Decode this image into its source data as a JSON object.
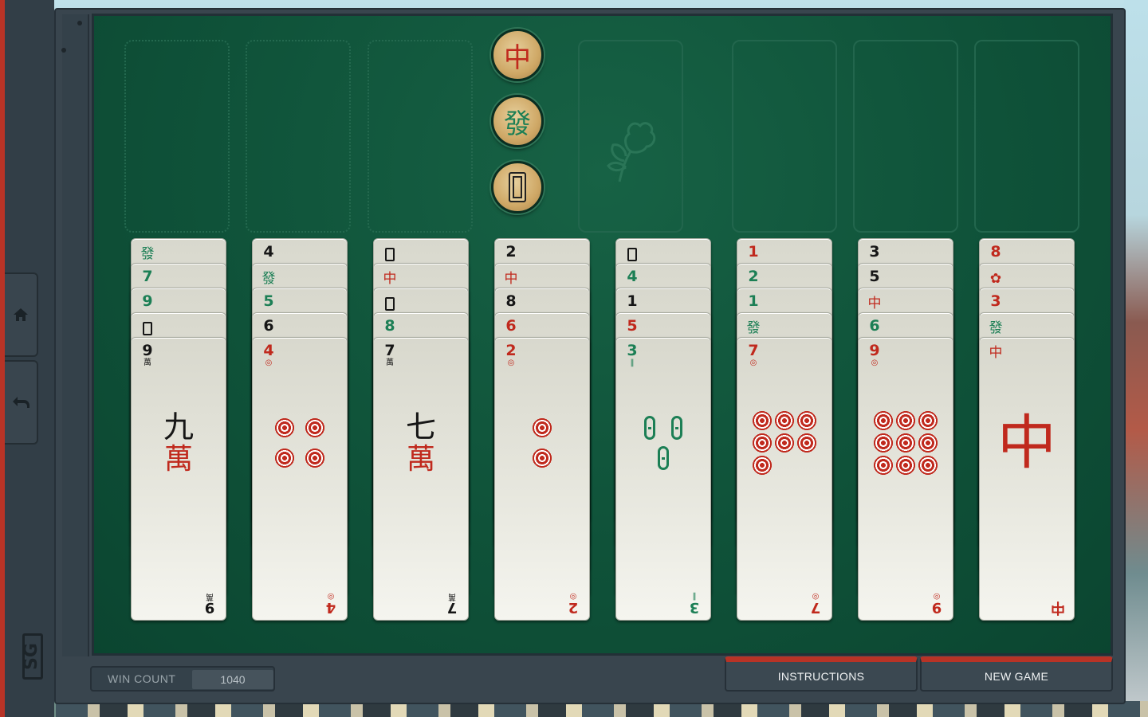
{
  "rail": {
    "home_icon": "home-icon",
    "undo_icon": "undo-icon",
    "logo_text": "SG"
  },
  "colors": {
    "felt": "#0f5239",
    "accent": "#b83326",
    "tile_red": "#c0291d",
    "tile_green": "#1c7f55",
    "tile_black": "#161616"
  },
  "dragon_buttons": [
    {
      "glyph": "中",
      "name": "red-dragon",
      "color": "red"
    },
    {
      "glyph": "發",
      "name": "green-dragon",
      "color": "green"
    },
    {
      "glyph": "",
      "name": "white-dragon",
      "color": "white"
    }
  ],
  "flower_slot": {
    "icon": "flower-icon"
  },
  "columns": [
    {
      "tags": [
        {
          "text": "發",
          "sub": "",
          "color": "green",
          "honor": true
        },
        {
          "text": "7",
          "sub": "",
          "color": "green",
          "honor": false
        },
        {
          "text": "9",
          "sub": "",
          "color": "green",
          "honor": false
        },
        {
          "text": "",
          "sub": "",
          "color": "black",
          "honor": true,
          "white": true
        },
        {
          "text": "9",
          "sub": "萬",
          "color": "black",
          "honor": false
        }
      ],
      "face": {
        "kind": "wan",
        "numch": "九",
        "wanch": "萬",
        "corner": "9",
        "corner_sub": "萬",
        "corner_color": "black"
      }
    },
    {
      "tags": [
        {
          "text": "4",
          "sub": "",
          "color": "black",
          "honor": false
        },
        {
          "text": "發",
          "sub": "",
          "color": "green",
          "honor": true
        },
        {
          "text": "5",
          "sub": "",
          "color": "green",
          "honor": false
        },
        {
          "text": "6",
          "sub": "",
          "color": "black",
          "honor": false
        },
        {
          "text": "4",
          "sub": "◎",
          "color": "red",
          "honor": false
        }
      ],
      "face": {
        "kind": "circles",
        "count": 4,
        "corner": "4",
        "corner_sub": "◎",
        "corner_color": "red"
      }
    },
    {
      "tags": [
        {
          "text": "",
          "sub": "",
          "color": "black",
          "honor": true,
          "white": true
        },
        {
          "text": "中",
          "sub": "",
          "color": "red",
          "honor": true
        },
        {
          "text": "",
          "sub": "",
          "color": "black",
          "honor": true,
          "white": true
        },
        {
          "text": "8",
          "sub": "",
          "color": "green",
          "honor": false
        },
        {
          "text": "7",
          "sub": "萬",
          "color": "black",
          "honor": false
        }
      ],
      "face": {
        "kind": "wan",
        "numch": "七",
        "wanch": "萬",
        "corner": "7",
        "corner_sub": "萬",
        "corner_color": "black"
      }
    },
    {
      "tags": [
        {
          "text": "2",
          "sub": "",
          "color": "black",
          "honor": false
        },
        {
          "text": "中",
          "sub": "",
          "color": "red",
          "honor": true
        },
        {
          "text": "8",
          "sub": "",
          "color": "black",
          "honor": false
        },
        {
          "text": "6",
          "sub": "",
          "color": "red",
          "honor": false
        },
        {
          "text": "2",
          "sub": "◎",
          "color": "red",
          "honor": false
        }
      ],
      "face": {
        "kind": "circles",
        "count": 2,
        "corner": "2",
        "corner_sub": "◎",
        "corner_color": "red"
      }
    },
    {
      "tags": [
        {
          "text": "",
          "sub": "",
          "color": "black",
          "honor": true,
          "white": true
        },
        {
          "text": "4",
          "sub": "",
          "color": "green",
          "honor": false
        },
        {
          "text": "1",
          "sub": "",
          "color": "black",
          "honor": false
        },
        {
          "text": "5",
          "sub": "",
          "color": "red",
          "honor": false
        },
        {
          "text": "3",
          "sub": "‖",
          "color": "green",
          "honor": false
        }
      ],
      "face": {
        "kind": "sticks",
        "count": 3,
        "corner": "3",
        "corner_sub": "‖",
        "corner_color": "green"
      }
    },
    {
      "tags": [
        {
          "text": "1",
          "sub": "",
          "color": "red",
          "honor": false
        },
        {
          "text": "2",
          "sub": "",
          "color": "green",
          "honor": false
        },
        {
          "text": "1",
          "sub": "",
          "color": "green",
          "honor": false
        },
        {
          "text": "發",
          "sub": "",
          "color": "green",
          "honor": true
        },
        {
          "text": "7",
          "sub": "◎",
          "color": "red",
          "honor": false
        }
      ],
      "face": {
        "kind": "circles",
        "count": 7,
        "corner": "7",
        "corner_sub": "◎",
        "corner_color": "red"
      }
    },
    {
      "tags": [
        {
          "text": "3",
          "sub": "",
          "color": "black",
          "honor": false
        },
        {
          "text": "5",
          "sub": "",
          "color": "black",
          "honor": false
        },
        {
          "text": "中",
          "sub": "",
          "color": "red",
          "honor": true
        },
        {
          "text": "6",
          "sub": "",
          "color": "green",
          "honor": false
        },
        {
          "text": "9",
          "sub": "◎",
          "color": "red",
          "honor": false
        }
      ],
      "face": {
        "kind": "circles",
        "count": 9,
        "corner": "9",
        "corner_sub": "◎",
        "corner_color": "red"
      }
    },
    {
      "tags": [
        {
          "text": "8",
          "sub": "",
          "color": "red",
          "honor": false
        },
        {
          "text": "✿",
          "sub": "",
          "color": "red",
          "honor": true
        },
        {
          "text": "3",
          "sub": "",
          "color": "red",
          "honor": false
        },
        {
          "text": "發",
          "sub": "",
          "color": "green",
          "honor": true
        },
        {
          "text": "中",
          "sub": "",
          "color": "red",
          "honor": true
        }
      ],
      "face": {
        "kind": "dragon",
        "glyph": "中",
        "corner": "中",
        "corner_sub": "",
        "corner_color": "red"
      }
    }
  ],
  "footer": {
    "win_count_label": "WIN COUNT",
    "win_count_value": "1040",
    "instructions_label": "INSTRUCTIONS",
    "new_game_label": "NEW GAME"
  }
}
